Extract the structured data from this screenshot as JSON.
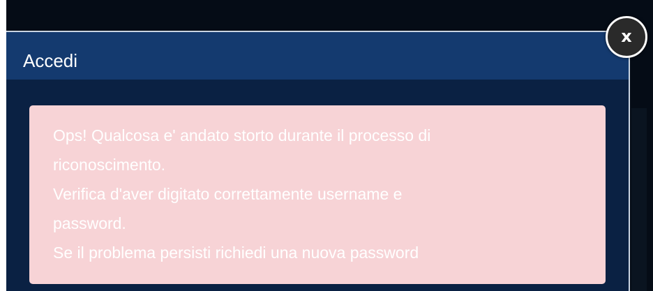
{
  "modal": {
    "title": "Accedi",
    "close_label": "x"
  },
  "alert": {
    "lines": [
      "Ops! Qualcosa e' andato storto durante il processo di",
      "riconoscimento.",
      "Verifica d'aver digitato correttamente username e",
      "password.",
      "Se il problema persisti richiedi una nuova password"
    ]
  },
  "colors": {
    "header": "#143a6f",
    "body": "#0a2143",
    "alert_bg": "#f7d3d6",
    "close_bg": "#2a2a2a"
  }
}
